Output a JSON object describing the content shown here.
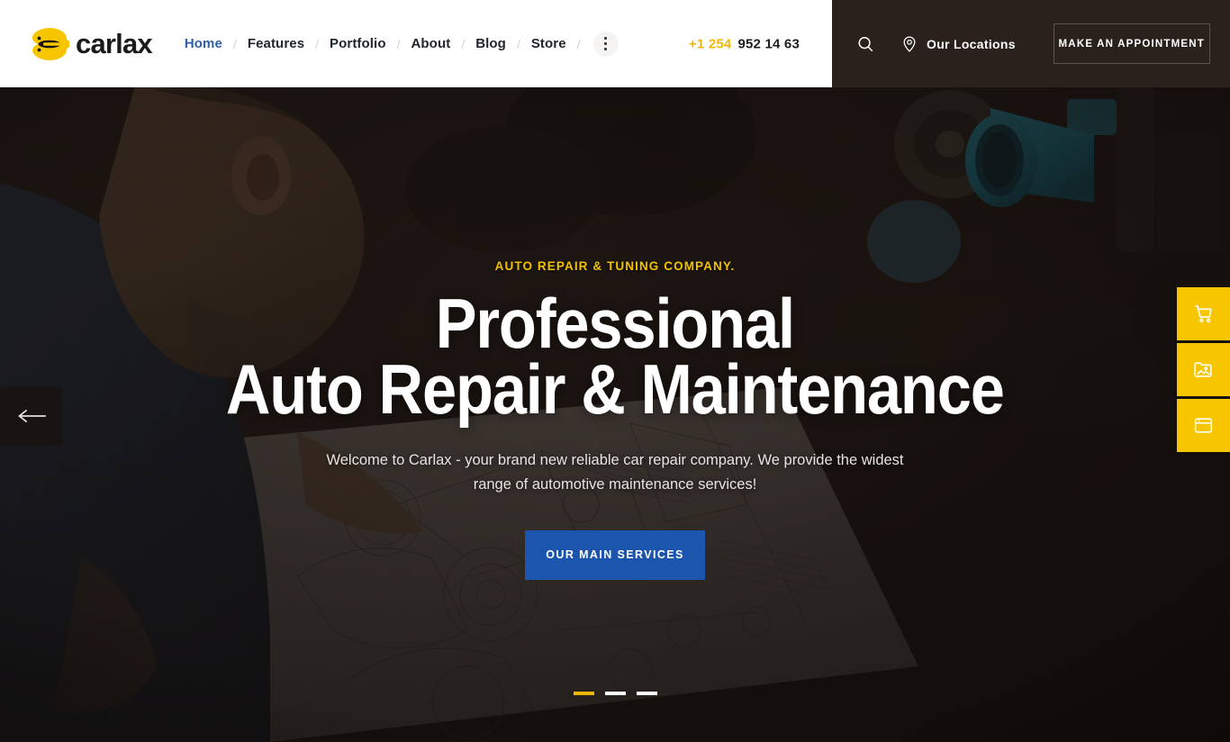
{
  "site": {
    "brand_name": "carlax",
    "accent_yellow": "#f7c600",
    "accent_blue": "#1b55ad",
    "header_dark": "#2a211d",
    "nav_active_color": "#2f5fa8"
  },
  "header": {
    "logo_label": "carlax",
    "logo_icon": "gear-wrench-icon",
    "nav": [
      {
        "label": "Home",
        "active": true
      },
      {
        "label": "Features",
        "active": false
      },
      {
        "label": "Portfolio",
        "active": false
      },
      {
        "label": "About",
        "active": false
      },
      {
        "label": "Blog",
        "active": false
      },
      {
        "label": "Store",
        "active": false
      }
    ],
    "nav_separator": "/",
    "more_menu_icon": "vertical-dots-icon",
    "phone_code": "+1 254",
    "phone_number": "952 14 63",
    "search_icon": "search-icon",
    "location_icon": "map-pin-icon",
    "locations_label": "Our Locations",
    "appointment_label": "MAKE AN APPOINTMENT"
  },
  "hero": {
    "subtitle": "AUTO REPAIR & TUNING COMPANY.",
    "title_line1": "Professional",
    "title_line2": "Auto Repair & Maintenance",
    "description": "Welcome to Carlax - your brand new reliable car repair company. We provide the widest range of automotive maintenance services!",
    "cta_label": "OUR MAIN SERVICES",
    "prev_arrow_icon": "arrow-left-icon",
    "slides": [
      {
        "active": true
      },
      {
        "active": false
      },
      {
        "active": false
      }
    ]
  },
  "side_rail": [
    {
      "icon": "shopping-cart-icon"
    },
    {
      "icon": "image-folder-icon"
    },
    {
      "icon": "browser-window-icon"
    }
  ]
}
